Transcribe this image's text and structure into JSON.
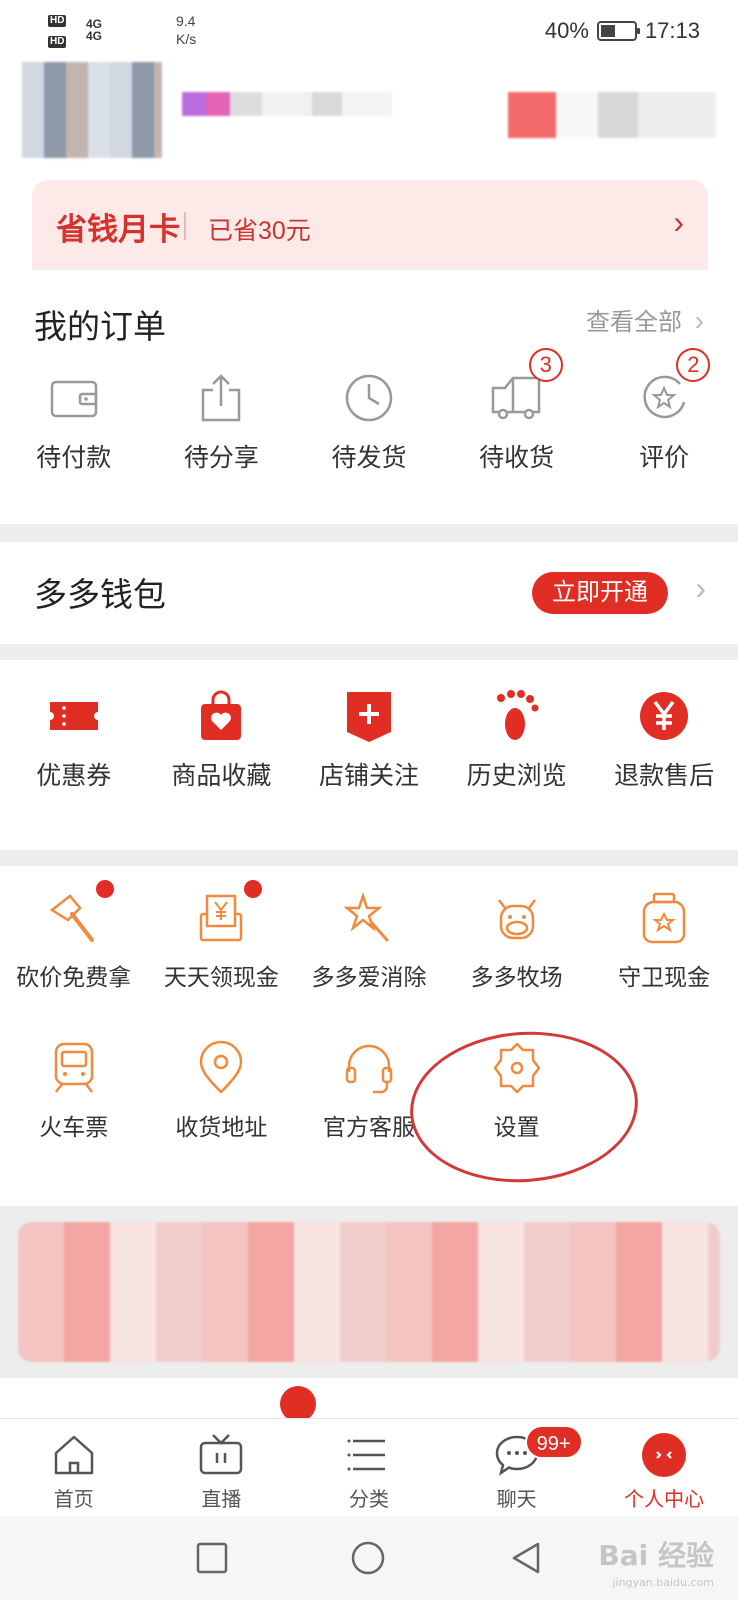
{
  "status_bar": {
    "network": "4G 4G",
    "speed": "9.4",
    "speed_unit": "K/s",
    "battery": "40%",
    "time": "17:13"
  },
  "money_card": {
    "title": "省钱月卡",
    "saved": "已省30元"
  },
  "orders": {
    "title": "我的订单",
    "see_all": "查看全部",
    "items": [
      {
        "label": "待付款",
        "icon": "wallet-icon",
        "badge": ""
      },
      {
        "label": "待分享",
        "icon": "share-icon",
        "badge": ""
      },
      {
        "label": "待发货",
        "icon": "clock-icon",
        "badge": ""
      },
      {
        "label": "待收货",
        "icon": "truck-icon",
        "badge": "3"
      },
      {
        "label": "评价",
        "icon": "star-review-icon",
        "badge": "2"
      }
    ]
  },
  "wallet": {
    "title": "多多钱包",
    "button": "立即开通"
  },
  "tools": [
    {
      "label": "优惠券",
      "icon": "coupon-icon"
    },
    {
      "label": "商品收藏",
      "icon": "heart-bag-icon"
    },
    {
      "label": "店铺关注",
      "icon": "store-plus-icon"
    },
    {
      "label": "历史浏览",
      "icon": "footprint-icon"
    },
    {
      "label": "退款售后",
      "icon": "yen-icon"
    }
  ],
  "services": [
    {
      "label": "砍价免费拿",
      "icon": "axe-icon",
      "dot": true
    },
    {
      "label": "天天领现金",
      "icon": "cash-envelope-icon",
      "dot": true
    },
    {
      "label": "多多爱消除",
      "icon": "magic-wand-icon",
      "dot": false
    },
    {
      "label": "多多牧场",
      "icon": "cow-icon",
      "dot": false
    },
    {
      "label": "守卫现金",
      "icon": "jar-icon",
      "dot": false
    },
    {
      "label": "火车票",
      "icon": "train-icon",
      "dot": false
    },
    {
      "label": "收货地址",
      "icon": "location-icon",
      "dot": false
    },
    {
      "label": "官方客服",
      "icon": "headset-icon",
      "dot": false
    },
    {
      "label": "设置",
      "icon": "gear-icon",
      "dot": false
    }
  ],
  "tabbar": [
    {
      "label": "首页",
      "icon": "home-icon"
    },
    {
      "label": "直播",
      "icon": "tv-icon"
    },
    {
      "label": "分类",
      "icon": "list-icon"
    },
    {
      "label": "聊天",
      "icon": "chat-icon",
      "badge": "99+"
    },
    {
      "label": "个人中心",
      "icon": "profile-icon"
    }
  ],
  "watermark": {
    "text": "Bai 经验",
    "sub": "jingyan.baidu.com"
  },
  "colors": {
    "accent": "#e02e24",
    "service_orange": "#f08a3c"
  }
}
